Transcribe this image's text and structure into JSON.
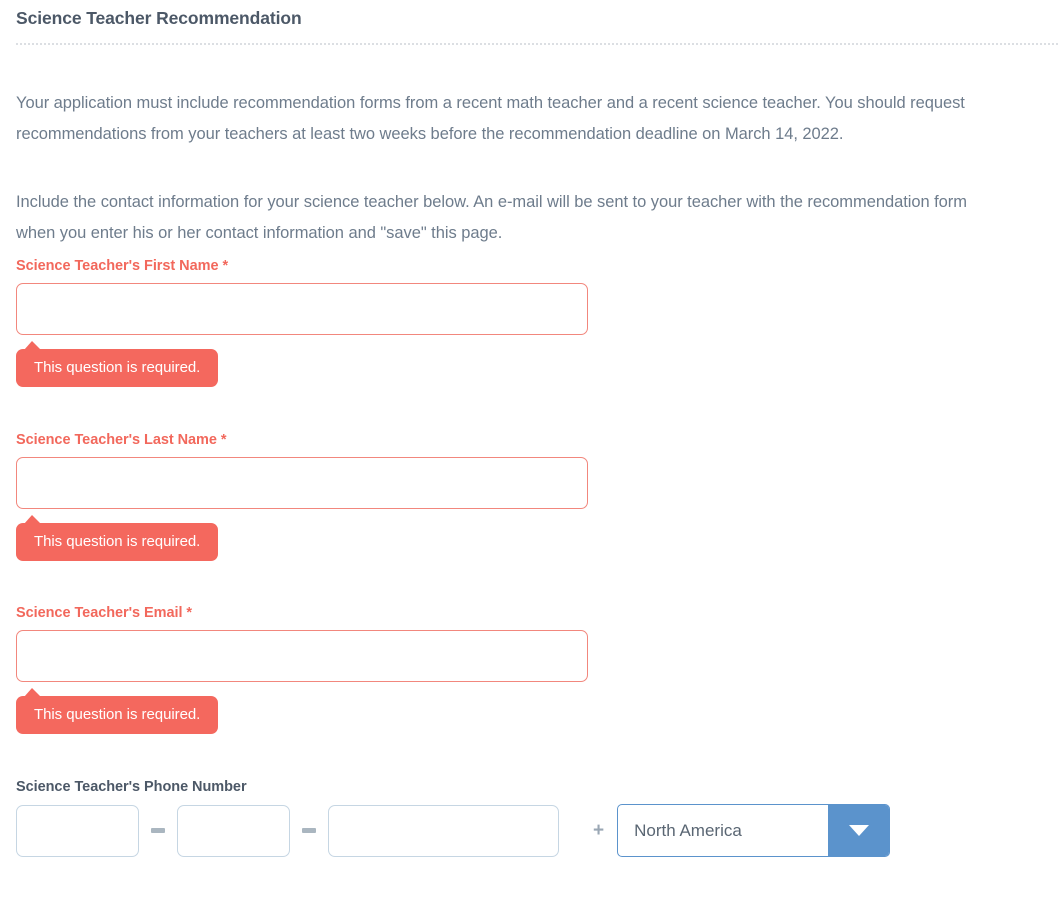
{
  "section": {
    "title": "Science Teacher Recommendation"
  },
  "intro": {
    "paragraph_1": "Your application must include recommendation forms from a recent math teacher and a recent science teacher. You should request recommendations from your teachers at least two weeks before the recommendation deadline on March 14, 2022.",
    "paragraph_2": "Include the contact information for your science teacher below. An e-mail will be sent to your teacher with the recommendation form when you enter his or her contact information and \"save\" this page."
  },
  "fields": [
    {
      "label": "Science Teacher's First Name *",
      "value": "",
      "placeholder": "",
      "error": "This question is required.",
      "required": true
    },
    {
      "label": "Science Teacher's Last Name *",
      "value": "",
      "placeholder": "",
      "error": "This question is required.",
      "required": true
    },
    {
      "label": "Science Teacher's Email *",
      "value": "",
      "placeholder": "",
      "error": "This question is required.",
      "required": true
    }
  ],
  "phone": {
    "label": "Science Teacher's Phone Number",
    "area_code": "",
    "prefix": "",
    "line_number": "",
    "separator": "-",
    "plus": "+",
    "region": {
      "selected": "North America",
      "options": [
        "North America"
      ],
      "arrow_icon": "chevron-down-icon"
    }
  },
  "colors": {
    "error_red": "#f4685e",
    "error_border": "#f2877d",
    "label_dark": "#4c5867",
    "body_text": "#6e7c8c",
    "select_blue": "#5b93cc",
    "input_border_blue": "#c6d6e3",
    "divider": "#dcdfe3"
  }
}
